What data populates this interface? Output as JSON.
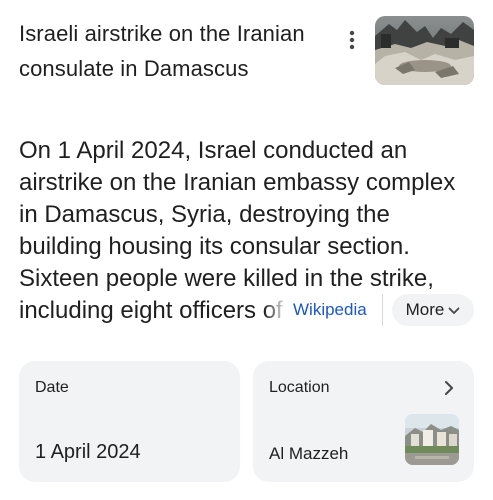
{
  "header": {
    "title": "Israeli airstrike on the Iranian consulate in Damascus",
    "menu_icon": "more-vert-icon",
    "thumbnail_icon": "airstrike-photo"
  },
  "description": {
    "text": "On 1 April 2024, Israel conducted an airstrike on the Iranian embassy complex in Damascus, Syria, destroying the building housing its consular section. Sixteen people were killed in the strike, including eight officers of",
    "source_label": "Wikipedia",
    "more_label": "More",
    "more_icon": "chevron-down-icon"
  },
  "cards": {
    "date": {
      "label": "Date",
      "value": "1 April 2024"
    },
    "location": {
      "label": "Location",
      "value": "Al Mazzeh",
      "arrow_icon": "chevron-right-icon",
      "thumbnail_icon": "location-photo"
    }
  },
  "colors": {
    "link": "#1a57c9",
    "card_bg": "#f1f3f4",
    "text": "#1f1f1f"
  }
}
